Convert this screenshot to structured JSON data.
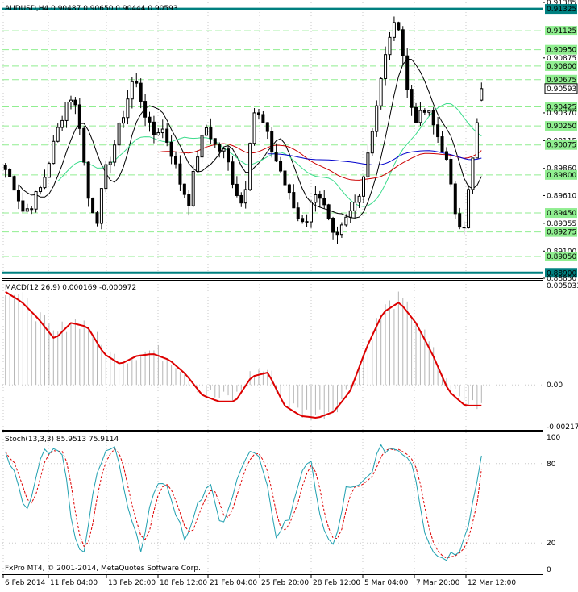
{
  "header": {
    "symbol_line": "AUDUSD,H4  0.90487 0.90650 0.90444 0.90593",
    "macd_label": "MACD(12,26,9) 0.000169 -0.000972",
    "stoch_label": "Stoch(13,3,3) 85.9513 75.9114",
    "copyright": "FxPro MT4, © 2001-2014, MetaQuotes Software Corp."
  },
  "colors": {
    "candle": "#000000",
    "level_line": "#008080",
    "dashed_level": "#90ee90",
    "ma_black": "#000000",
    "ma_green": "#3cdc8c",
    "ma_red": "#cc0000",
    "ma_blue": "#0000cc",
    "macd_hist": "#b4b4b4",
    "macd_signal": "#dd0000",
    "stoch_main": "#20a0b0",
    "stoch_signal": "#dd0000",
    "price_tag_bg": "#008080",
    "current_tag_bg": "#ffffff"
  },
  "price_axis": {
    "labels": [
      "0.91385",
      "0.91325",
      "0.91125",
      "0.90950",
      "0.90875",
      "0.90800",
      "0.90675",
      "0.90593",
      "0.90425",
      "0.90370",
      "0.90250",
      "0.90115",
      "0.90075",
      "0.89860",
      "0.89800",
      "0.89610",
      "0.89450",
      "0.89355",
      "0.89275",
      "0.89100",
      "0.89050",
      "0.88900",
      "0.88850"
    ],
    "highlighted": [
      "0.91325",
      "0.91125",
      "0.90950",
      "0.90800",
      "0.90675",
      "0.90425",
      "0.90250",
      "0.90075",
      "0.89800",
      "0.89450",
      "0.89275",
      "0.89050",
      "0.88900"
    ],
    "current_price": "0.90593",
    "solid_levels": [
      "0.91325",
      "0.88900"
    ]
  },
  "macd_axis": {
    "labels": [
      "0.005033",
      "0.00",
      "-0.002173"
    ]
  },
  "stoch_axis": {
    "labels": [
      "100",
      "80",
      "20",
      "0"
    ]
  },
  "time_axis": {
    "labels": [
      "6 Feb 2014",
      "11 Feb 04:00",
      "13 Feb 20:00",
      "18 Feb 12:00",
      "21 Feb 04:00",
      "25 Feb 20:00",
      "28 Feb 12:00",
      "5 Mar 04:00",
      "7 Mar 20:00",
      "12 Mar 12:00"
    ]
  },
  "chart_data": [
    {
      "type": "candlestick",
      "title": "AUDUSD,H4",
      "ylim": [
        0.8885,
        0.91385
      ],
      "x": [
        "6 Feb 2014",
        "11 Feb 04:00",
        "13 Feb 20:00",
        "18 Feb 12:00",
        "21 Feb 04:00",
        "25 Feb 20:00",
        "28 Feb 12:00",
        "5 Mar 04:00",
        "7 Mar 20:00",
        "12 Mar 12:00"
      ],
      "close_path": [
        0.8985,
        0.897,
        0.8945,
        0.8955,
        0.897,
        0.9,
        0.903,
        0.9055,
        0.9035,
        0.896,
        0.894,
        0.8985,
        0.901,
        0.904,
        0.907,
        0.9045,
        0.9015,
        0.9025,
        0.9005,
        0.8975,
        0.8955,
        0.9,
        0.9025,
        0.9005,
        0.9,
        0.897,
        0.895,
        0.904,
        0.903,
        0.9005,
        0.8985,
        0.896,
        0.894,
        0.894,
        0.897,
        0.8945,
        0.8915,
        0.8935,
        0.895,
        0.8975,
        0.902,
        0.9065,
        0.911,
        0.912,
        0.905,
        0.903,
        0.904,
        0.902,
        0.9,
        0.895,
        0.893,
        0.899,
        0.9059
      ],
      "last": {
        "open": 0.90487,
        "high": 0.9065,
        "low": 0.90444,
        "close": 0.90593
      }
    },
    {
      "type": "line",
      "title": "MACD(12,26,9)",
      "values_label": [
        0.000169,
        -0.000972
      ],
      "ylim": [
        -0.002173,
        0.005033
      ],
      "signal_path": [
        0.0045,
        0.004,
        0.0032,
        0.0022,
        0.003,
        0.0028,
        0.0015,
        0.001,
        0.0014,
        0.0015,
        0.0012,
        0.0005,
        -0.0005,
        -0.0008,
        -0.0008,
        0.0004,
        0.0006,
        -0.001,
        -0.0015,
        -0.0016,
        -0.0013,
        -0.0003,
        0.0018,
        0.0035,
        0.004,
        0.003,
        0.0015,
        -0.0003,
        -0.001,
        -0.001
      ]
    },
    {
      "type": "line",
      "title": "Stoch(13,3,3)",
      "values_label": [
        85.9513,
        75.9114
      ],
      "ylim": [
        0,
        100
      ],
      "levels": [
        80,
        20
      ],
      "main_path": [
        90,
        70,
        40,
        85,
        90,
        88,
        30,
        10,
        75,
        95,
        85,
        40,
        15,
        60,
        70,
        40,
        20,
        50,
        70,
        30,
        50,
        85,
        90,
        70,
        20,
        40,
        70,
        80,
        30,
        15,
        60,
        60,
        70,
        90,
        92,
        90,
        80,
        30,
        10,
        10,
        15,
        40,
        86
      ]
    }
  ]
}
